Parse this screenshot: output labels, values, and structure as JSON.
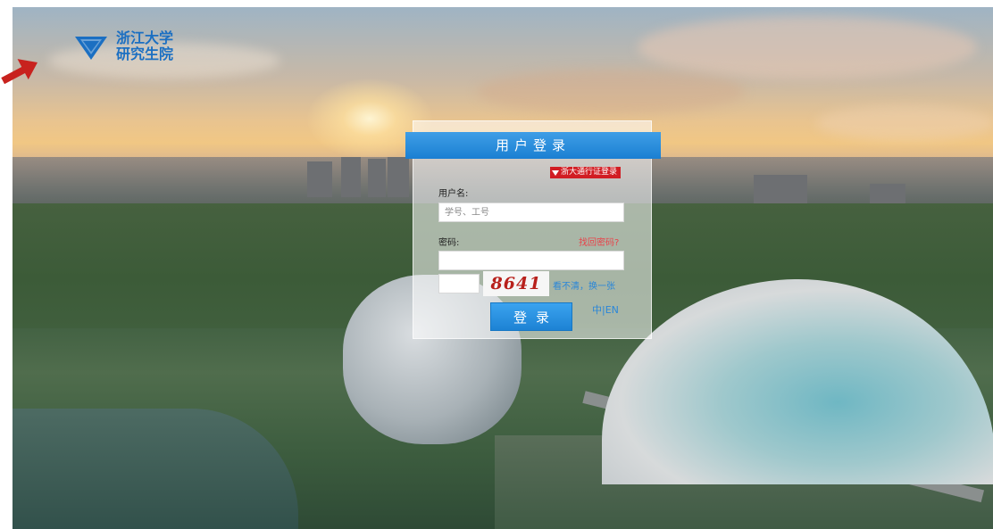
{
  "brand": {
    "line1": "浙江大学",
    "line2": "研究生院",
    "color": "#1b6fc2"
  },
  "login": {
    "title": "用户登录",
    "tongji_link": "浙大通行证登录",
    "username_label": "用户名:",
    "username_placeholder": "学号、工号",
    "password_label": "密码:",
    "forgot_link": "找回密码?",
    "captcha_text": "8641",
    "refresh_link": "看不清，换一张",
    "submit_label": "登录",
    "lang_zh": "中",
    "lang_sep": "|",
    "lang_en": "EN"
  },
  "colors": {
    "accent_blue": "#1a7fd2",
    "red": "#d11d23",
    "arrow": "#c8221e"
  },
  "icons": {
    "arrow": "red-arrow-icon",
    "logo": "zju-logo-icon",
    "tongji": "triangle-down-icon"
  }
}
